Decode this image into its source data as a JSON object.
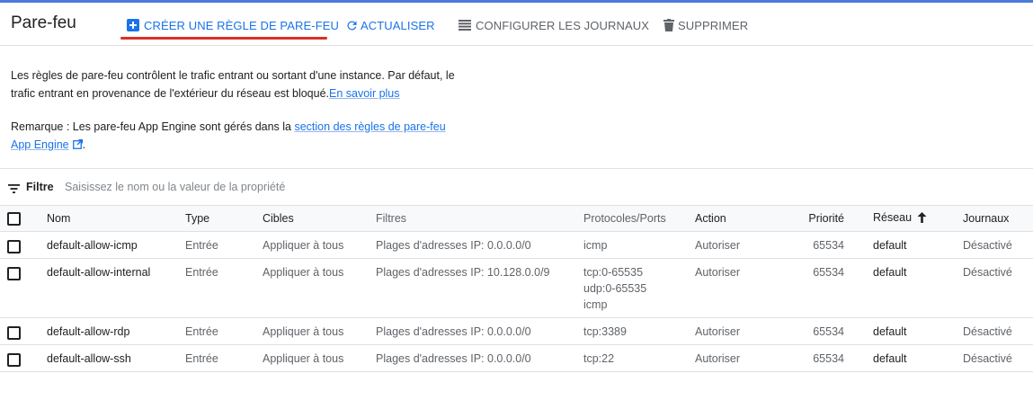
{
  "header": {
    "title": "Pare-feu",
    "create_label": "CRÉER UNE RÈGLE DE PARE-FEU",
    "refresh_label": "ACTUALISER",
    "logs_label": "CONFIGURER LES JOURNAUX",
    "delete_label": "SUPPRIMER"
  },
  "intro": {
    "line1": "Les règles de pare-feu contrôlent le trafic entrant ou sortant d'une instance. Par défaut, le",
    "line2": "trafic entrant en provenance de l'extérieur du réseau est bloqué.",
    "learn_more": "En savoir plus",
    "note_prefix": "Remarque : Les pare-feu App Engine sont gérés dans la ",
    "note_link_part1": "section des règles de pare-feu",
    "note_link_part2": "App Engine",
    "note_suffix": "."
  },
  "filter": {
    "label": "Filtre",
    "placeholder": "Saisissez le nom ou la valeur de la propriété"
  },
  "table": {
    "columns": {
      "name": "Nom",
      "type": "Type",
      "targets": "Cibles",
      "filters": "Filtres",
      "protocols": "Protocoles/Ports",
      "action": "Action",
      "priority": "Priorité",
      "network": "Réseau",
      "logs": "Journaux"
    },
    "rows": [
      {
        "name": "default-allow-icmp",
        "type": "Entrée",
        "targets": "Appliquer à tous",
        "filters": "Plages d'adresses IP: 0.0.0.0/0",
        "protocols": [
          "icmp"
        ],
        "action": "Autoriser",
        "priority": "65534",
        "network": "default",
        "logs": "Désactivé"
      },
      {
        "name": "default-allow-internal",
        "type": "Entrée",
        "targets": "Appliquer à tous",
        "filters": "Plages d'adresses IP: 10.128.0.0/9",
        "protocols": [
          "tcp:0-65535",
          "udp:0-65535",
          "icmp"
        ],
        "action": "Autoriser",
        "priority": "65534",
        "network": "default",
        "logs": "Désactivé"
      },
      {
        "name": "default-allow-rdp",
        "type": "Entrée",
        "targets": "Appliquer à tous",
        "filters": "Plages d'adresses IP: 0.0.0.0/0",
        "protocols": [
          "tcp:3389"
        ],
        "action": "Autoriser",
        "priority": "65534",
        "network": "default",
        "logs": "Désactivé"
      },
      {
        "name": "default-allow-ssh",
        "type": "Entrée",
        "targets": "Appliquer à tous",
        "filters": "Plages d'adresses IP: 0.0.0.0/0",
        "protocols": [
          "tcp:22"
        ],
        "action": "Autoriser",
        "priority": "65534",
        "network": "default",
        "logs": "Désactivé"
      }
    ]
  },
  "colors": {
    "accent": "#1a73e8",
    "active_underline": "#d93025",
    "top_line": "#4a7bd8"
  },
  "icons": [
    "plus-box-icon",
    "refresh-icon",
    "logs-list-icon",
    "trash-icon",
    "external-link-icon",
    "filter-icon",
    "arrow-up-icon"
  ]
}
